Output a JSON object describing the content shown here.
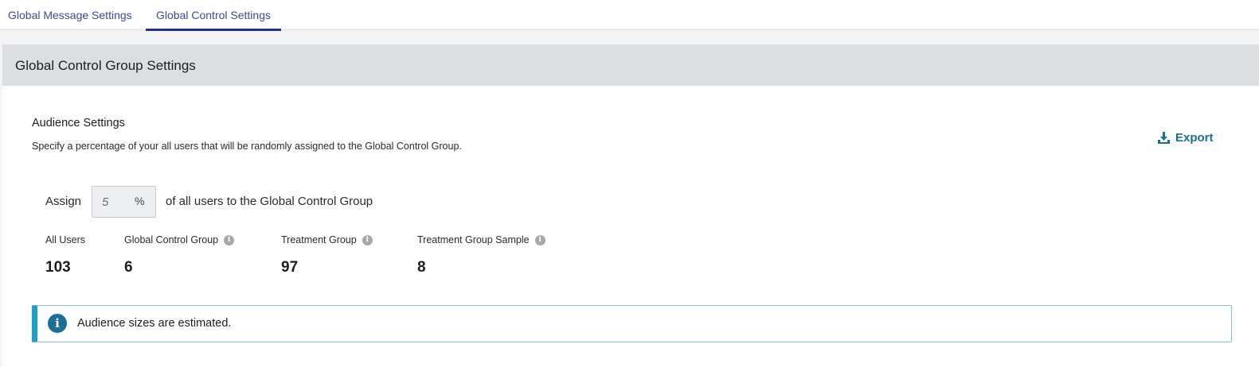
{
  "tabs": [
    {
      "label": "Global Message Settings",
      "active": false
    },
    {
      "label": "Global Control Settings",
      "active": true
    }
  ],
  "panel": {
    "title": "Global Control Group Settings"
  },
  "audience": {
    "title": "Audience Settings",
    "description": "Specify a percentage of your all users that will be randomly assigned to the Global Control Group.",
    "export_label": "Export",
    "export_icon": "download-icon",
    "assign_prefix": "Assign",
    "percentage_value": "5",
    "percent_sign": "%",
    "assign_suffix": "of all users to the Global Control Group"
  },
  "stats": [
    {
      "label": "All Users",
      "value": "103",
      "has_info": false
    },
    {
      "label": "Global Control Group",
      "value": "6",
      "has_info": true
    },
    {
      "label": "Treatment Group",
      "value": "97",
      "has_info": true
    },
    {
      "label": "Treatment Group Sample",
      "value": "8",
      "has_info": true
    }
  ],
  "notice": {
    "icon": "info-icon",
    "text": "Audience sizes are estimated."
  },
  "colors": {
    "accent": "#27308a",
    "link": "#1b6f94",
    "notice_border": "#1aa0c6",
    "header_bg": "#dcdfe2"
  }
}
